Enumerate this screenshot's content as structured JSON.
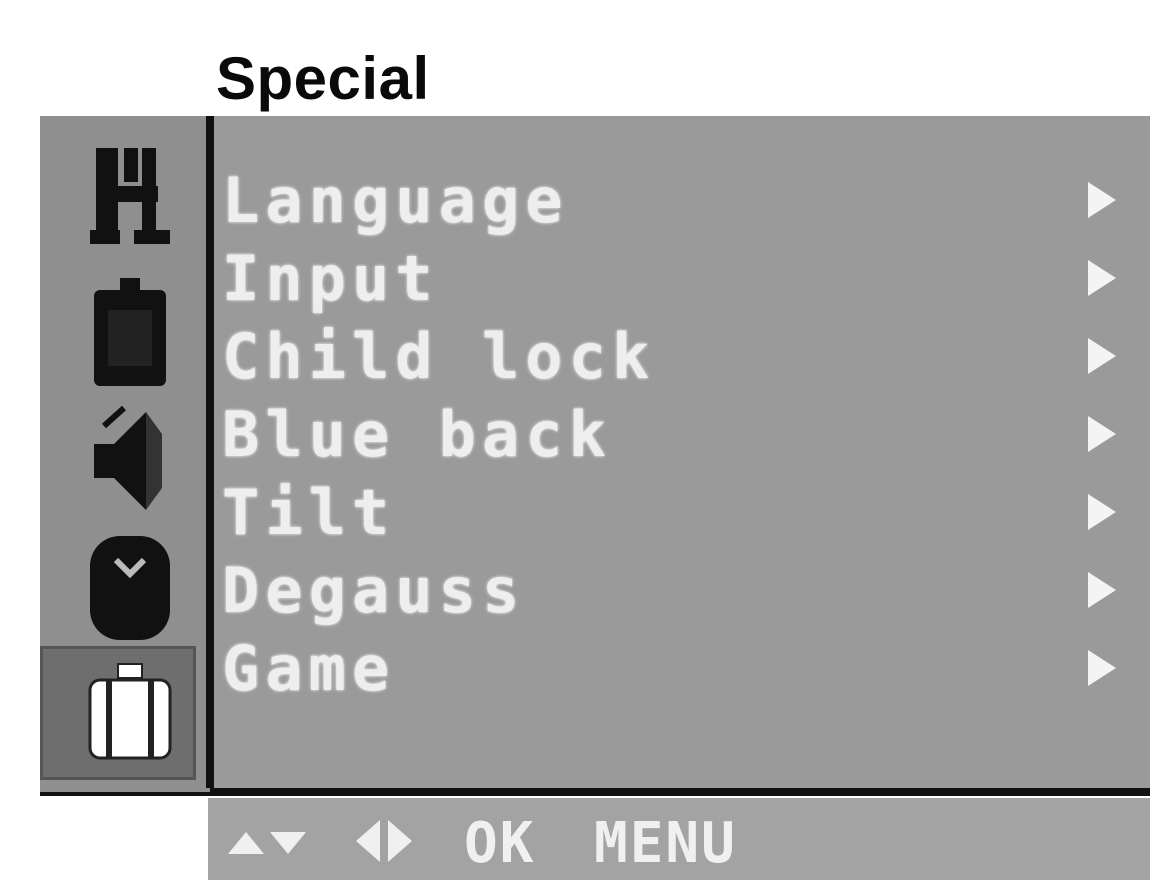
{
  "title": "Special",
  "sidebar": {
    "icons": [
      {
        "name": "picture-icon"
      },
      {
        "name": "battery-icon"
      },
      {
        "name": "speaker-icon"
      },
      {
        "name": "timer-icon"
      },
      {
        "name": "toolbox-icon",
        "selected": true
      }
    ]
  },
  "menu": {
    "items": [
      {
        "label": "Language"
      },
      {
        "label": "Input"
      },
      {
        "label": "Child lock"
      },
      {
        "label": "Blue back"
      },
      {
        "label": "Tilt"
      },
      {
        "label": "Degauss"
      },
      {
        "label": "Game"
      }
    ]
  },
  "help_bar": {
    "ok_label": "OK",
    "menu_label": "MENU"
  },
  "colors": {
    "panel": "#9a9a9a",
    "sidebar": "#8f8f8f",
    "text": "#eeeeee",
    "frame": "#111111"
  }
}
